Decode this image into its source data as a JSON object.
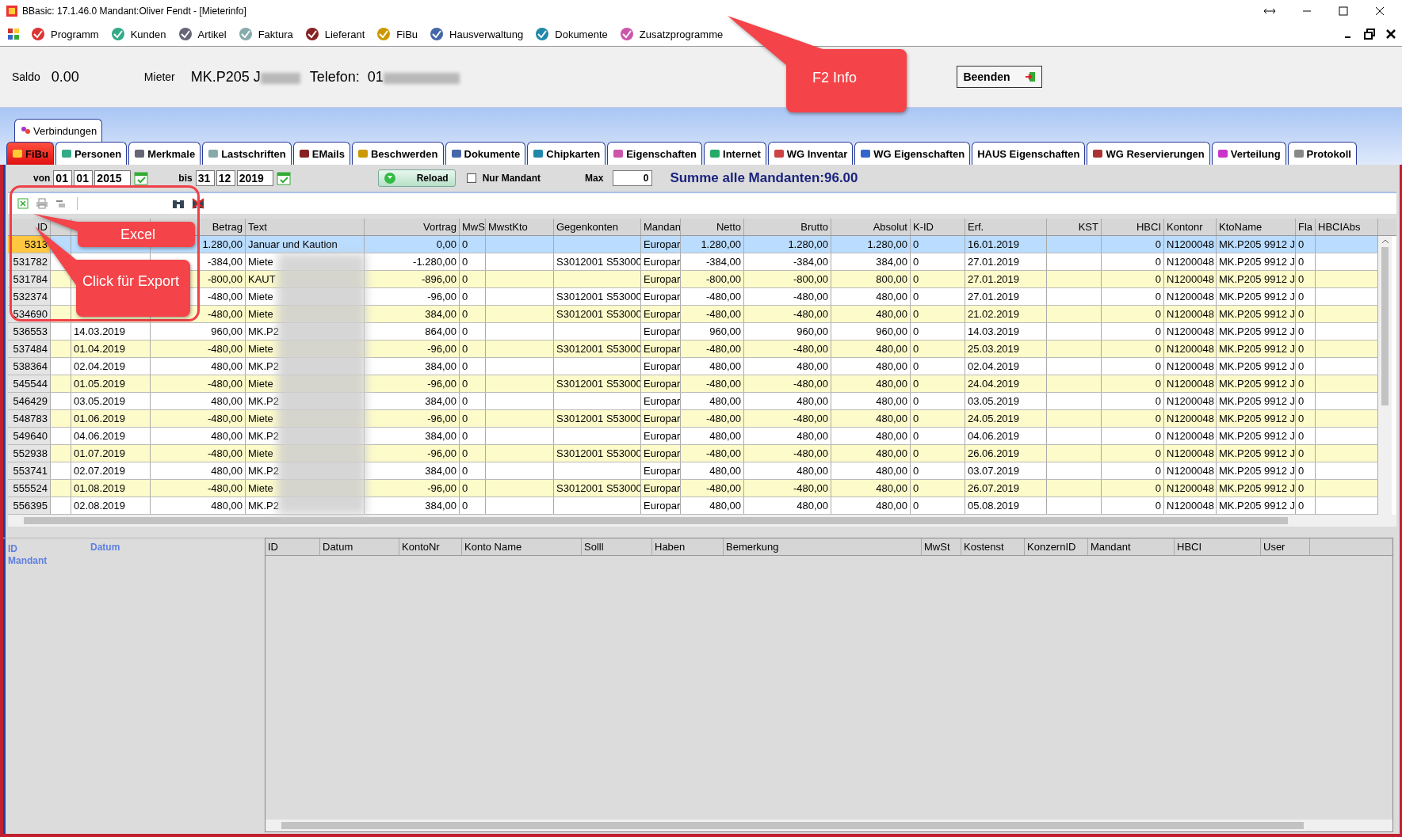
{
  "window": {
    "title": "BBasic: 17.1.46.0 Mandant:Oliver Fendt  - [Mieterinfo]"
  },
  "menu": [
    "Programm",
    "Kunden",
    "Artikel",
    "Faktura",
    "Lieferant",
    "FiBu",
    "Hausverwaltung",
    "Dokumente",
    "Zusatzprogramme"
  ],
  "header": {
    "saldo_label": "Saldo",
    "saldo": "0.00",
    "mieter_label": "Mieter",
    "mieter": "MK.P205 J",
    "telefon_label": "Telefon:",
    "telefon": "01",
    "quit_button": "Beenden"
  },
  "upper_tab": {
    "label": "Verbindungen"
  },
  "tabs": [
    {
      "label": "FiBu",
      "selected": true,
      "has_icon": true
    },
    {
      "label": "Personen",
      "selected": false,
      "has_icon": true
    },
    {
      "label": "Merkmale",
      "selected": false,
      "has_icon": true
    },
    {
      "label": "Lastschriften",
      "selected": false,
      "has_icon": true
    },
    {
      "label": "EMails",
      "selected": false,
      "has_icon": true
    },
    {
      "label": "Beschwerden",
      "selected": false,
      "has_icon": true
    },
    {
      "label": "Dokumente",
      "selected": false,
      "has_icon": true
    },
    {
      "label": "Chipkarten",
      "selected": false,
      "has_icon": true
    },
    {
      "label": "Eigenschaften",
      "selected": false,
      "has_icon": true
    },
    {
      "label": "Internet",
      "selected": false,
      "has_icon": true
    },
    {
      "label": "WG Inventar",
      "selected": false,
      "has_icon": true
    },
    {
      "label": "WG Eigenschaften",
      "selected": false,
      "has_icon": true
    },
    {
      "label": "HAUS Eigenschaften",
      "selected": false,
      "has_icon": false
    },
    {
      "label": "WG Reservierungen",
      "selected": false,
      "has_icon": true
    },
    {
      "label": "Verteilung",
      "selected": false,
      "has_icon": true
    },
    {
      "label": "Protokoll",
      "selected": false,
      "has_icon": true
    }
  ],
  "filter": {
    "from_label": "von",
    "from": [
      "01",
      "01",
      "2015"
    ],
    "to_label": "bis",
    "to": [
      "31",
      "12",
      "2019"
    ],
    "reload_button": "Reload",
    "only_mandant": {
      "label": "Nur Mandant",
      "checked": false
    },
    "max_label": "Max",
    "max": "0",
    "sum": "Summe alle Mandanten:96.00"
  },
  "table": {
    "columns": [
      {
        "label": "ID",
        "kind": "number"
      },
      {
        "kind": "text"
      },
      {
        "kind": "text"
      },
      {
        "label": "Betrag",
        "kind": "number"
      },
      {
        "label": "Text",
        "kind": "text"
      },
      {
        "label": "Vortrag",
        "kind": "number"
      },
      {
        "label": "MwS",
        "kind": "text"
      },
      {
        "label": "MwstKto",
        "kind": "text"
      },
      {
        "label": "Gegenkonten",
        "kind": "text"
      },
      {
        "label": "Mandan",
        "kind": "text"
      },
      {
        "label": "Netto",
        "kind": "number"
      },
      {
        "label": "Brutto",
        "kind": "number"
      },
      {
        "label": "Absolut",
        "kind": "number"
      },
      {
        "label": "K-ID",
        "kind": "text"
      },
      {
        "label": "Erf.",
        "kind": "text"
      },
      {
        "label": "KST",
        "kind": "number"
      },
      {
        "label": "HBCI",
        "kind": "number"
      },
      {
        "label": "Kontonr",
        "kind": "text"
      },
      {
        "label": "KtoName",
        "kind": "text"
      },
      {
        "label": "Fla",
        "kind": "text"
      },
      {
        "label": "HBCIAbs",
        "kind": "text"
      }
    ],
    "rows": [
      {
        "selected": true,
        "cells": [
          "5313",
          "",
          "",
          "1.280,00",
          "Januar und Kaution",
          "0,00",
          "0",
          "",
          "",
          "Europar",
          "1.280,00",
          "1.280,00",
          "1.280,00",
          "0",
          "16.01.2019",
          "",
          "0",
          "N1200048",
          "MK.P205 9912 J",
          "0",
          ""
        ]
      },
      {
        "selected": false,
        "cells": [
          "531782",
          "",
          "",
          "-384,00",
          "Miete",
          "-1.280,00",
          "0",
          "",
          "S3012001 S53000",
          "Europar",
          "-384,00",
          "-384,00",
          "384,00",
          "0",
          "27.01.2019",
          "",
          "0",
          "N1200048",
          "MK.P205 9912 J",
          "0",
          ""
        ]
      },
      {
        "selected": false,
        "cells": [
          "531784",
          "",
          "",
          "-800,00",
          "KAUT",
          "-896,00",
          "0",
          "",
          "",
          "Europar",
          "-800,00",
          "-800,00",
          "800,00",
          "0",
          "27.01.2019",
          "",
          "0",
          "N1200048",
          "MK.P205 9912 J",
          "0",
          ""
        ]
      },
      {
        "selected": false,
        "cells": [
          "532374",
          "",
          "",
          "-480,00",
          "Miete",
          "-96,00",
          "0",
          "",
          "S3012001 S53000",
          "Europar",
          "-480,00",
          "-480,00",
          "480,00",
          "0",
          "27.01.2019",
          "",
          "0",
          "N1200048",
          "MK.P205 9912 J",
          "0",
          ""
        ]
      },
      {
        "selected": false,
        "cells": [
          "534690",
          "",
          "",
          "-480,00",
          "Miete",
          "384,00",
          "0",
          "",
          "S3012001 S53000",
          "Europar",
          "-480,00",
          "-480,00",
          "480,00",
          "0",
          "21.02.2019",
          "",
          "0",
          "N1200048",
          "MK.P205 9912 J",
          "0",
          ""
        ]
      },
      {
        "selected": false,
        "cells": [
          "536553",
          "",
          "14.03.2019",
          "960,00",
          "MK.P2",
          "864,00",
          "0",
          "",
          "",
          "Europar",
          "960,00",
          "960,00",
          "960,00",
          "0",
          "14.03.2019",
          "",
          "0",
          "N1200048",
          "MK.P205 9912 J",
          "0",
          ""
        ]
      },
      {
        "selected": false,
        "cells": [
          "537484",
          "",
          "01.04.2019",
          "-480,00",
          "Miete",
          "-96,00",
          "0",
          "",
          "S3012001 S53000",
          "Europar",
          "-480,00",
          "-480,00",
          "480,00",
          "0",
          "25.03.2019",
          "",
          "0",
          "N1200048",
          "MK.P205 9912 J",
          "0",
          ""
        ]
      },
      {
        "selected": false,
        "cells": [
          "538364",
          "",
          "02.04.2019",
          "480,00",
          "MK.P2",
          "384,00",
          "0",
          "",
          "",
          "Europar",
          "480,00",
          "480,00",
          "480,00",
          "0",
          "02.04.2019",
          "",
          "0",
          "N1200048",
          "MK.P205 9912 J",
          "0",
          ""
        ]
      },
      {
        "selected": false,
        "cells": [
          "545544",
          "",
          "01.05.2019",
          "-480,00",
          "Miete",
          "-96,00",
          "0",
          "",
          "S3012001 S53000",
          "Europar",
          "-480,00",
          "-480,00",
          "480,00",
          "0",
          "24.04.2019",
          "",
          "0",
          "N1200048",
          "MK.P205 9912 J",
          "0",
          ""
        ]
      },
      {
        "selected": false,
        "cells": [
          "546429",
          "",
          "03.05.2019",
          "480,00",
          "MK.P2",
          "384,00",
          "0",
          "",
          "",
          "Europar",
          "480,00",
          "480,00",
          "480,00",
          "0",
          "03.05.2019",
          "",
          "0",
          "N1200048",
          "MK.P205 9912 J",
          "0",
          ""
        ]
      },
      {
        "selected": false,
        "cells": [
          "548783",
          "",
          "01.06.2019",
          "-480,00",
          "Miete",
          "-96,00",
          "0",
          "",
          "S3012001 S53000",
          "Europar",
          "-480,00",
          "-480,00",
          "480,00",
          "0",
          "24.05.2019",
          "",
          "0",
          "N1200048",
          "MK.P205 9912 J",
          "0",
          ""
        ]
      },
      {
        "selected": false,
        "cells": [
          "549640",
          "",
          "04.06.2019",
          "480,00",
          "MK.P2",
          "384,00",
          "0",
          "",
          "",
          "Europar",
          "480,00",
          "480,00",
          "480,00",
          "0",
          "04.06.2019",
          "",
          "0",
          "N1200048",
          "MK.P205 9912 J",
          "0",
          ""
        ]
      },
      {
        "selected": false,
        "cells": [
          "552938",
          "",
          "01.07.2019",
          "-480,00",
          "Miete",
          "-96,00",
          "0",
          "",
          "S3012001 S53000",
          "Europar",
          "-480,00",
          "-480,00",
          "480,00",
          "0",
          "26.06.2019",
          "",
          "0",
          "N1200048",
          "MK.P205 9912 J",
          "0",
          ""
        ]
      },
      {
        "selected": false,
        "cells": [
          "553741",
          "",
          "02.07.2019",
          "480,00",
          "MK.P2",
          "384,00",
          "0",
          "",
          "",
          "Europar",
          "480,00",
          "480,00",
          "480,00",
          "0",
          "03.07.2019",
          "",
          "0",
          "N1200048",
          "MK.P205 9912 J",
          "0",
          ""
        ]
      },
      {
        "selected": false,
        "cells": [
          "555524",
          "",
          "01.08.2019",
          "-480,00",
          "Miete",
          "-96,00",
          "0",
          "",
          "S3012001 S53000",
          "Europar",
          "-480,00",
          "-480,00",
          "480,00",
          "0",
          "26.07.2019",
          "",
          "0",
          "N1200048",
          "MK.P205 9912 J",
          "0",
          ""
        ]
      },
      {
        "selected": false,
        "cells": [
          "556395",
          "",
          "02.08.2019",
          "480,00",
          "MK.P2",
          "384,00",
          "0",
          "",
          "",
          "Europar",
          "480,00",
          "480,00",
          "480,00",
          "0",
          "05.08.2019",
          "",
          "0",
          "N1200048",
          "MK.P205 9912 J",
          "0",
          ""
        ]
      }
    ]
  },
  "detail_labels": [
    "ID",
    "Datum",
    "Mandant"
  ],
  "detail_table": {
    "columns": [
      "ID",
      "Datum",
      "KontoNr",
      "Konto Name",
      "Solll",
      "Haben",
      "Bemerkung",
      "MwSt",
      "Kostenst",
      "KonzernID",
      "Mandant",
      "HBCI",
      "User"
    ]
  },
  "annotations": [
    {
      "text": "F2 Info"
    },
    {
      "text": "Excel"
    },
    {
      "text": "Click für Export"
    }
  ]
}
